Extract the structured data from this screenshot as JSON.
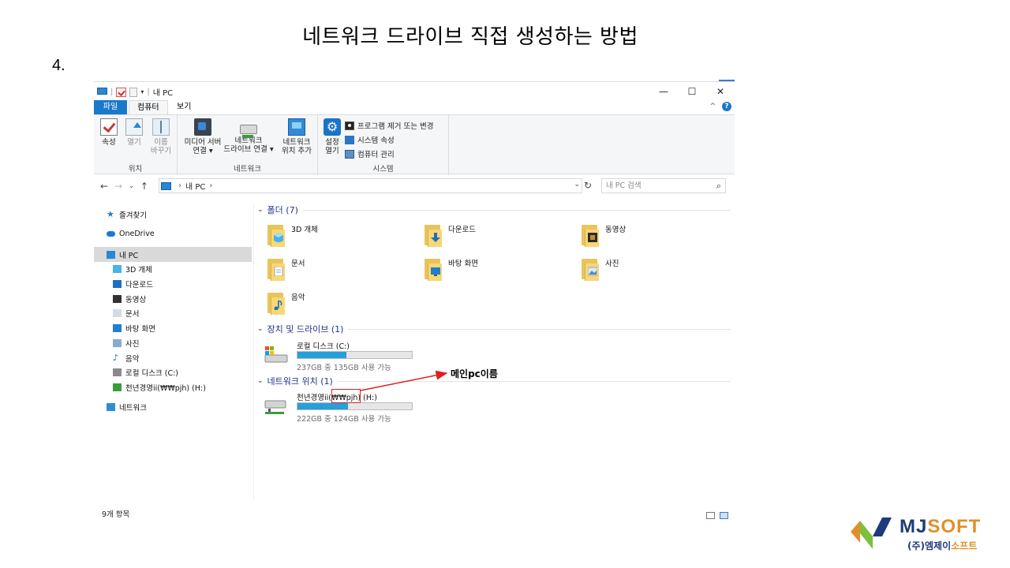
{
  "slide": {
    "title": "네트워크 드라이브 직접 생성하는 방법",
    "step": "4."
  },
  "window": {
    "title": "내 PC",
    "controls": {
      "minimize": "—",
      "maximize": "☐",
      "close": "✕"
    }
  },
  "ribbon": {
    "tabs": {
      "file": "파일",
      "computer": "컴퓨터",
      "view": "보기"
    },
    "location_group": {
      "label": "위치",
      "properties": "속성",
      "open": "열기",
      "rename_line1": "이름",
      "rename_line2": "바꾸기"
    },
    "network_group": {
      "label": "네트워크",
      "media_server_line1": "미디어 서버",
      "media_server_line2": "연결 ▾",
      "map_drive_line1": "네트워크",
      "map_drive_line2": "드라이브 연결 ▾",
      "add_location_line1": "네트워크",
      "add_location_line2": "위치 추가"
    },
    "system_group": {
      "label": "시스템",
      "settings_line1": "설정",
      "settings_line2": "열기",
      "uninstall": "프로그램 제거 또는 변경",
      "system_props": "시스템 속성",
      "manage": "컴퓨터 관리"
    }
  },
  "addressbar": {
    "path_item": "내 PC",
    "search_placeholder": "내 PC 검색"
  },
  "nav_pane": {
    "items": [
      {
        "label": "즐겨찾기",
        "icon": "star-icon"
      },
      {
        "label": "OneDrive",
        "icon": "cloud-icon"
      },
      {
        "label": "내 PC",
        "icon": "pc-icon"
      },
      {
        "label": "3D 개체",
        "icon": "cube-icon"
      },
      {
        "label": "다운로드",
        "icon": "download-icon"
      },
      {
        "label": "동영상",
        "icon": "video-icon"
      },
      {
        "label": "문서",
        "icon": "document-icon"
      },
      {
        "label": "바탕 화면",
        "icon": "desktop-icon"
      },
      {
        "label": "사진",
        "icon": "picture-icon"
      },
      {
        "label": "음악",
        "icon": "music-icon"
      },
      {
        "label": "로컬 디스크 (C:)",
        "icon": "local-disk-icon"
      },
      {
        "label": "천년경영ii(₩₩pjh) (H:)",
        "icon": "network-drive-icon"
      },
      {
        "label": "네트워크",
        "icon": "network-icon"
      }
    ]
  },
  "content": {
    "folders_header": "폴더 (7)",
    "folders": [
      {
        "label": "3D 개체",
        "overlay": "cube"
      },
      {
        "label": "다운로드",
        "overlay": "download"
      },
      {
        "label": "동영상",
        "overlay": "film"
      },
      {
        "label": "문서",
        "overlay": "document"
      },
      {
        "label": "바탕 화면",
        "overlay": "desktop"
      },
      {
        "label": "사진",
        "overlay": "picture"
      },
      {
        "label": "음악",
        "overlay": "music"
      }
    ],
    "devices_header": "장치 및 드라이브 (1)",
    "local_disk": {
      "name": "로컬 디스크 (C:)",
      "space": "237GB 중 135GB 사용 가능",
      "used_fraction": 0.43
    },
    "network_header": "네트워크 위치 (1)",
    "network_drive": {
      "name": "천년경영ii(₩₩pjh) (H:)",
      "space": "222GB 중 124GB 사용 가능",
      "used_fraction": 0.44
    }
  },
  "status_bar": {
    "count": "9개 항목"
  },
  "annotation": {
    "label": "메인pc이름",
    "color": "#e02020"
  },
  "brand": {
    "mark": "MJ",
    "name_suffix": "SOFT",
    "sub_a": "(주)엠제이",
    "sub_b": "소프트",
    "navy": "#1c3b7a",
    "orange": "#e0902a",
    "green": "#7fbf3f"
  },
  "colors": {
    "accent": "#1979ca",
    "drive_fill": "#26a0da",
    "section_header": "#1e3287"
  }
}
